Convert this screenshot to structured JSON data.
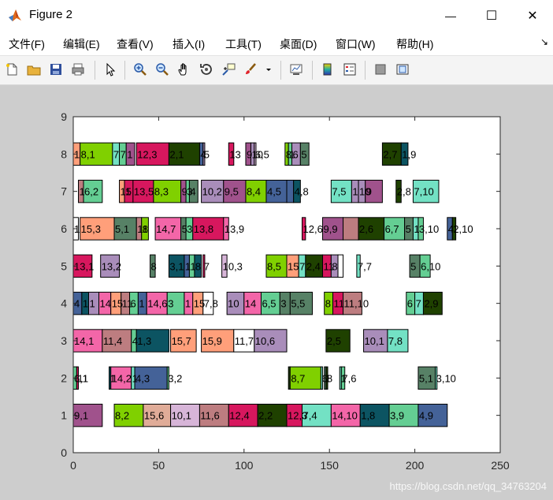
{
  "window": {
    "title": "Figure 2",
    "minimize_glyph": "—",
    "maximize_glyph": "☐",
    "close_glyph": "✕"
  },
  "menu": {
    "items": [
      "文件(F)",
      "编辑(E)",
      "查看(V)",
      "插入(I)",
      "工具(T)",
      "桌面(D)",
      "窗口(W)",
      "帮助(H)"
    ],
    "overflow_glyph": "↘"
  },
  "toolbar": {
    "icons": [
      "new-figure-icon",
      "open-file-icon",
      "save-icon",
      "print-icon",
      "edit-plot-arrow-icon",
      "zoom-in-icon",
      "zoom-out-icon",
      "pan-hand-icon",
      "rotate-3d-icon",
      "data-cursor-icon",
      "brush-icon",
      "brush-dropdown-icon",
      "link-plot-icon",
      "insert-colorbar-icon",
      "insert-legend-icon",
      "hide-plot-tools-icon",
      "show-plot-tools-icon"
    ]
  },
  "watermark": "https://blog.csdn.net/qq_34763204",
  "colors": {
    "c1": "#a0528c",
    "c2": "#80d000",
    "c3": "#e0ac98",
    "c4": "#d7b5d8",
    "c5": "#bd7d80",
    "c6": "#d7175e",
    "c7": "#1f4100",
    "c8": "#ff9f7a",
    "c9": "#f366a8",
    "c10": "#0c5462",
    "c11": "#446298",
    "c12": "#64ce93",
    "c13": "#578166",
    "c14": "#73e1c4",
    "c15": "#a98dba",
    "canvas_bg": "#cdcdcd",
    "axes_bg": "#ffffff"
  },
  "chart_data": {
    "type": "gantt",
    "xlim": [
      0,
      250
    ],
    "ylim": [
      0,
      9
    ],
    "xticks": [
      0,
      50,
      100,
      150,
      200,
      250
    ],
    "yticks": [
      0,
      1,
      2,
      3,
      4,
      5,
      6,
      7,
      8,
      9
    ],
    "grid": false,
    "tasks": [
      {
        "y": 1,
        "start": 0,
        "end": 17,
        "label": "9,1",
        "color": "#a0528c"
      },
      {
        "y": 1,
        "start": 24,
        "end": 41,
        "label": "8,2",
        "color": "#80d000"
      },
      {
        "y": 1,
        "start": 41,
        "end": 57,
        "label": "15,6",
        "color": "#e0ac98"
      },
      {
        "y": 1,
        "start": 57,
        "end": 74,
        "label": "10,1",
        "color": "#d7b5d8"
      },
      {
        "y": 1,
        "start": 74,
        "end": 91,
        "label": "11,6",
        "color": "#bd7d80"
      },
      {
        "y": 1,
        "start": 91,
        "end": 108,
        "label": "12,4",
        "color": "#d7175e"
      },
      {
        "y": 1,
        "start": 108,
        "end": 125,
        "label": "2,2",
        "color": "#1f4100"
      },
      {
        "y": 1,
        "start": 125,
        "end": 134,
        "label": "12,3",
        "color": "#d7175e"
      },
      {
        "y": 1,
        "start": 134,
        "end": 151,
        "label": "7,4",
        "color": "#73e1c4"
      },
      {
        "y": 1,
        "start": 151,
        "end": 168,
        "label": "14,10",
        "color": "#f366a8"
      },
      {
        "y": 1,
        "start": 168,
        "end": 185,
        "label": "1,8",
        "color": "#0c5462"
      },
      {
        "y": 1,
        "start": 185,
        "end": 202,
        "label": "3,9",
        "color": "#64ce93"
      },
      {
        "y": 1,
        "start": 202,
        "end": 219,
        "label": "4,9",
        "color": "#446298"
      },
      {
        "y": 2,
        "start": 0,
        "end": 2,
        "label": "6,1",
        "color": "#64ce93"
      },
      {
        "y": 2,
        "start": 2,
        "end": 3,
        "label": "11",
        "color": "#d7175e"
      },
      {
        "y": 2,
        "start": 21,
        "end": 22,
        "label": "1",
        "color": "#0c5462"
      },
      {
        "y": 2,
        "start": 22,
        "end": 34,
        "label": "14,2",
        "color": "#f366a8"
      },
      {
        "y": 2,
        "start": 34,
        "end": 36,
        "label": "1",
        "color": "#73e1c4"
      },
      {
        "y": 2,
        "start": 36,
        "end": 55,
        "label": "4,3",
        "color": "#446298"
      },
      {
        "y": 2,
        "start": 55,
        "end": 56,
        "label": "3,2",
        "color": "#64ce93"
      },
      {
        "y": 2,
        "start": 126,
        "end": 127,
        "label": "",
        "color": "#1f4100"
      },
      {
        "y": 2,
        "start": 127,
        "end": 145,
        "label": "8,7",
        "color": "#80d000"
      },
      {
        "y": 2,
        "start": 145,
        "end": 146,
        "label": "6",
        "color": "#73e1c4"
      },
      {
        "y": 2,
        "start": 147,
        "end": 148,
        "label": "1",
        "color": "#578166"
      },
      {
        "y": 2,
        "start": 148,
        "end": 149,
        "label": "8",
        "color": "#1f4100"
      },
      {
        "y": 2,
        "start": 156,
        "end": 157,
        "label": "1",
        "color": "#73e1c4"
      },
      {
        "y": 2,
        "start": 157,
        "end": 159,
        "label": "7,6",
        "color": "#64ce93"
      },
      {
        "y": 2,
        "start": 202,
        "end": 212,
        "label": "5,1",
        "color": "#578166"
      },
      {
        "y": 2,
        "start": 212,
        "end": 213,
        "label": "3,10",
        "color": "#73e1c4"
      },
      {
        "y": 3,
        "start": 0,
        "end": 17,
        "label": "14,1",
        "color": "#f366a8"
      },
      {
        "y": 3,
        "start": 17,
        "end": 34,
        "label": "11,4",
        "color": "#bd7d80"
      },
      {
        "y": 3,
        "start": 34,
        "end": 37,
        "label": "4",
        "color": "#64ce93"
      },
      {
        "y": 3,
        "start": 37,
        "end": 56,
        "label": "1,3",
        "color": "#0c5462"
      },
      {
        "y": 3,
        "start": 57,
        "end": 72,
        "label": "15,7",
        "color": "#ff9f7a"
      },
      {
        "y": 3,
        "start": 75,
        "end": 94,
        "label": "15,9",
        "color": "#ff9f7a"
      },
      {
        "y": 3,
        "start": 94,
        "end": 106,
        "label": "11,7",
        "color": "#ffffff"
      },
      {
        "y": 3,
        "start": 106,
        "end": 125,
        "label": "10,6",
        "color": "#a98dba"
      },
      {
        "y": 3,
        "start": 148,
        "end": 162,
        "label": "2,5",
        "color": "#1f4100"
      },
      {
        "y": 3,
        "start": 170,
        "end": 184,
        "label": "10,1",
        "color": "#a98dba"
      },
      {
        "y": 3,
        "start": 184,
        "end": 196,
        "label": "7,8",
        "color": "#73e1c4"
      },
      {
        "y": 4,
        "start": 0,
        "end": 5,
        "label": "4",
        "color": "#446298"
      },
      {
        "y": 4,
        "start": 5,
        "end": 9,
        "label": "1",
        "color": "#0c5462"
      },
      {
        "y": 4,
        "start": 9,
        "end": 15,
        "label": "1",
        "color": "#a98dba"
      },
      {
        "y": 4,
        "start": 15,
        "end": 22,
        "label": "14",
        "color": "#f366a8"
      },
      {
        "y": 4,
        "start": 22,
        "end": 28,
        "label": "15",
        "color": "#ff9f7a"
      },
      {
        "y": 4,
        "start": 28,
        "end": 33,
        "label": "11",
        "color": "#bd7d80"
      },
      {
        "y": 4,
        "start": 33,
        "end": 38,
        "label": "6",
        "color": "#64ce93"
      },
      {
        "y": 4,
        "start": 38,
        "end": 43,
        "label": "1",
        "color": "#446298"
      },
      {
        "y": 4,
        "start": 43,
        "end": 55,
        "label": "14,6",
        "color": "#f366a8"
      },
      {
        "y": 4,
        "start": 55,
        "end": 65,
        "label": "3",
        "color": "#64ce93"
      },
      {
        "y": 4,
        "start": 65,
        "end": 70,
        "label": "1",
        "color": "#f366a8"
      },
      {
        "y": 4,
        "start": 70,
        "end": 76,
        "label": "15",
        "color": "#ff9f7a"
      },
      {
        "y": 4,
        "start": 76,
        "end": 82,
        "label": "7,8",
        "color": "#ffffff"
      },
      {
        "y": 4,
        "start": 90,
        "end": 100,
        "label": "10",
        "color": "#a98dba"
      },
      {
        "y": 4,
        "start": 100,
        "end": 110,
        "label": "14",
        "color": "#f366a8"
      },
      {
        "y": 4,
        "start": 110,
        "end": 121,
        "label": "6,5",
        "color": "#64ce93"
      },
      {
        "y": 4,
        "start": 121,
        "end": 127,
        "label": "3",
        "color": "#578166"
      },
      {
        "y": 4,
        "start": 127,
        "end": 140,
        "label": "5,5",
        "color": "#578166"
      },
      {
        "y": 4,
        "start": 147,
        "end": 152,
        "label": "8",
        "color": "#80d000"
      },
      {
        "y": 4,
        "start": 152,
        "end": 158,
        "label": "11",
        "color": "#d7175e"
      },
      {
        "y": 4,
        "start": 158,
        "end": 169,
        "label": "11,10",
        "color": "#bd7d80"
      },
      {
        "y": 4,
        "start": 195,
        "end": 200,
        "label": "6",
        "color": "#64ce93"
      },
      {
        "y": 4,
        "start": 200,
        "end": 205,
        "label": "7",
        "color": "#73e1c4"
      },
      {
        "y": 4,
        "start": 205,
        "end": 216,
        "label": "2,9",
        "color": "#1f4100"
      },
      {
        "y": 5,
        "start": 0,
        "end": 11,
        "label": "13,1",
        "color": "#d7175e"
      },
      {
        "y": 5,
        "start": 16,
        "end": 27,
        "label": "13,2",
        "color": "#a98dba"
      },
      {
        "y": 5,
        "start": 45,
        "end": 48,
        "label": "8",
        "color": "#578166"
      },
      {
        "y": 5,
        "start": 56,
        "end": 65,
        "label": "3,1",
        "color": "#0c5462"
      },
      {
        "y": 5,
        "start": 65,
        "end": 68,
        "label": "1",
        "color": "#446298"
      },
      {
        "y": 5,
        "start": 68,
        "end": 71,
        "label": "1",
        "color": "#64ce93"
      },
      {
        "y": 5,
        "start": 71,
        "end": 75,
        "label": "8",
        "color": "#0c5462"
      },
      {
        "y": 5,
        "start": 76,
        "end": 77,
        "label": "7",
        "color": "#d7175e"
      },
      {
        "y": 5,
        "start": 87,
        "end": 90,
        "label": "10,3",
        "color": "#d7b5d8"
      },
      {
        "y": 5,
        "start": 113,
        "end": 125,
        "label": "8,5",
        "color": "#80d000"
      },
      {
        "y": 5,
        "start": 125,
        "end": 132,
        "label": "15",
        "color": "#ff9f7a"
      },
      {
        "y": 5,
        "start": 132,
        "end": 136,
        "label": "7",
        "color": "#73e1c4"
      },
      {
        "y": 5,
        "start": 136,
        "end": 146,
        "label": "2,4",
        "color": "#1f4100"
      },
      {
        "y": 5,
        "start": 146,
        "end": 151,
        "label": "11",
        "color": "#d7175e"
      },
      {
        "y": 5,
        "start": 151,
        "end": 155,
        "label": "8",
        "color": "#a98dba"
      },
      {
        "y": 5,
        "start": 155,
        "end": 158,
        "label": "",
        "color": "#ffffff"
      },
      {
        "y": 5,
        "start": 166,
        "end": 168,
        "label": "7,7",
        "color": "#73e1c4"
      },
      {
        "y": 5,
        "start": 197,
        "end": 203,
        "label": "5",
        "color": "#578166"
      },
      {
        "y": 5,
        "start": 203,
        "end": 209,
        "label": "6,10",
        "color": "#64ce93"
      },
      {
        "y": 6,
        "start": 0,
        "end": 3,
        "label": "1",
        "color": "#ffffff"
      },
      {
        "y": 6,
        "start": 4,
        "end": 24,
        "label": "15,3",
        "color": "#ff9f7a"
      },
      {
        "y": 6,
        "start": 24,
        "end": 37,
        "label": "5,1",
        "color": "#578166"
      },
      {
        "y": 6,
        "start": 37,
        "end": 40,
        "label": "11",
        "color": "#bd7d80"
      },
      {
        "y": 6,
        "start": 40,
        "end": 44,
        "label": "8",
        "color": "#80d000"
      },
      {
        "y": 6,
        "start": 48,
        "end": 63,
        "label": "14,7",
        "color": "#f366a8"
      },
      {
        "y": 6,
        "start": 63,
        "end": 66,
        "label": "5",
        "color": "#578166"
      },
      {
        "y": 6,
        "start": 66,
        "end": 70,
        "label": "3",
        "color": "#64ce93"
      },
      {
        "y": 6,
        "start": 70,
        "end": 88,
        "label": "13,8",
        "color": "#d7175e"
      },
      {
        "y": 6,
        "start": 88,
        "end": 91,
        "label": "13,9",
        "color": "#f366a8"
      },
      {
        "y": 6,
        "start": 134,
        "end": 136,
        "label": "12,6",
        "color": "#d7175e"
      },
      {
        "y": 6,
        "start": 146,
        "end": 158,
        "label": "9,9",
        "color": "#a0528c"
      },
      {
        "y": 6,
        "start": 158,
        "end": 167,
        "label": "",
        "color": "#bd7d80"
      },
      {
        "y": 6,
        "start": 167,
        "end": 182,
        "label": "2,6",
        "color": "#1f4100"
      },
      {
        "y": 6,
        "start": 182,
        "end": 194,
        "label": "6,7",
        "color": "#64ce93"
      },
      {
        "y": 6,
        "start": 194,
        "end": 199,
        "label": "5",
        "color": "#578166"
      },
      {
        "y": 6,
        "start": 199,
        "end": 202,
        "label": "1",
        "color": "#73e1c4"
      },
      {
        "y": 6,
        "start": 202,
        "end": 205,
        "label": "3,10",
        "color": "#64ce93"
      },
      {
        "y": 6,
        "start": 219,
        "end": 222,
        "label": "4",
        "color": "#446298"
      },
      {
        "y": 6,
        "start": 222,
        "end": 224,
        "label": "2,10",
        "color": "#1f4100"
      },
      {
        "y": 7,
        "start": 3,
        "end": 6,
        "label": "1",
        "color": "#bd7d80"
      },
      {
        "y": 7,
        "start": 6,
        "end": 17,
        "label": "6,2",
        "color": "#64ce93"
      },
      {
        "y": 7,
        "start": 27,
        "end": 30,
        "label": "15",
        "color": "#ff9f7a"
      },
      {
        "y": 7,
        "start": 30,
        "end": 35,
        "label": "1",
        "color": "#d7175e"
      },
      {
        "y": 7,
        "start": 35,
        "end": 47,
        "label": "13,5",
        "color": "#d7175e"
      },
      {
        "y": 7,
        "start": 47,
        "end": 63,
        "label": "8,3",
        "color": "#80d000"
      },
      {
        "y": 7,
        "start": 63,
        "end": 66,
        "label": "9",
        "color": "#a0528c"
      },
      {
        "y": 7,
        "start": 66,
        "end": 68,
        "label": "3",
        "color": "#64ce93"
      },
      {
        "y": 7,
        "start": 68,
        "end": 73,
        "label": "4",
        "color": "#578166"
      },
      {
        "y": 7,
        "start": 75,
        "end": 88,
        "label": "10,2",
        "color": "#a98dba"
      },
      {
        "y": 7,
        "start": 88,
        "end": 101,
        "label": "9,5",
        "color": "#a0528c"
      },
      {
        "y": 7,
        "start": 101,
        "end": 113,
        "label": "8,4",
        "color": "#80d000"
      },
      {
        "y": 7,
        "start": 113,
        "end": 125,
        "label": "4,5",
        "color": "#446298"
      },
      {
        "y": 7,
        "start": 125,
        "end": 129,
        "label": "",
        "color": "#446298"
      },
      {
        "y": 7,
        "start": 129,
        "end": 133,
        "label": "4,8",
        "color": "#0c5462"
      },
      {
        "y": 7,
        "start": 151,
        "end": 163,
        "label": "7,5",
        "color": "#73e1c4"
      },
      {
        "y": 7,
        "start": 163,
        "end": 167,
        "label": "1",
        "color": "#a98dba"
      },
      {
        "y": 7,
        "start": 167,
        "end": 171,
        "label": "10",
        "color": "#a98dba"
      },
      {
        "y": 7,
        "start": 171,
        "end": 181,
        "label": "9",
        "color": "#a0528c"
      },
      {
        "y": 7,
        "start": 189,
        "end": 192,
        "label": "2,8",
        "color": "#1f4100"
      },
      {
        "y": 7,
        "start": 199,
        "end": 214,
        "label": "7,10",
        "color": "#73e1c4"
      },
      {
        "y": 8,
        "start": 0,
        "end": 4,
        "label": "1",
        "color": "#ff9f7a"
      },
      {
        "y": 8,
        "start": 4,
        "end": 23,
        "label": "8,1",
        "color": "#80d000"
      },
      {
        "y": 8,
        "start": 23,
        "end": 27,
        "label": "7",
        "color": "#73e1c4"
      },
      {
        "y": 8,
        "start": 27,
        "end": 31,
        "label": "7",
        "color": "#64ce93"
      },
      {
        "y": 8,
        "start": 31,
        "end": 36,
        "label": "1",
        "color": "#a0528c"
      },
      {
        "y": 8,
        "start": 37,
        "end": 56,
        "label": "12,3",
        "color": "#d7175e"
      },
      {
        "y": 8,
        "start": 56,
        "end": 74,
        "label": "2,1",
        "color": "#1f4100"
      },
      {
        "y": 8,
        "start": 74,
        "end": 76,
        "label": "4",
        "color": "#446298"
      },
      {
        "y": 8,
        "start": 76,
        "end": 77,
        "label": "5",
        "color": "#a98dba"
      },
      {
        "y": 8,
        "start": 91,
        "end": 94,
        "label": "13",
        "color": "#d7175e"
      },
      {
        "y": 8,
        "start": 101,
        "end": 104,
        "label": "9",
        "color": "#a0528c"
      },
      {
        "y": 8,
        "start": 104,
        "end": 106,
        "label": "10",
        "color": "#a98dba"
      },
      {
        "y": 8,
        "start": 106,
        "end": 107,
        "label": "6,5",
        "color": "#d7b5d8"
      },
      {
        "y": 8,
        "start": 124,
        "end": 126,
        "label": "8",
        "color": "#80d000"
      },
      {
        "y": 8,
        "start": 126,
        "end": 128,
        "label": "1",
        "color": "#64ce93"
      },
      {
        "y": 8,
        "start": 128,
        "end": 133,
        "label": "6",
        "color": "#a98dba"
      },
      {
        "y": 8,
        "start": 133,
        "end": 138,
        "label": "5",
        "color": "#578166"
      },
      {
        "y": 8,
        "start": 181,
        "end": 192,
        "label": "2,7",
        "color": "#1f4100"
      },
      {
        "y": 8,
        "start": 192,
        "end": 196,
        "label": "1,9",
        "color": "#0c5462"
      }
    ]
  }
}
